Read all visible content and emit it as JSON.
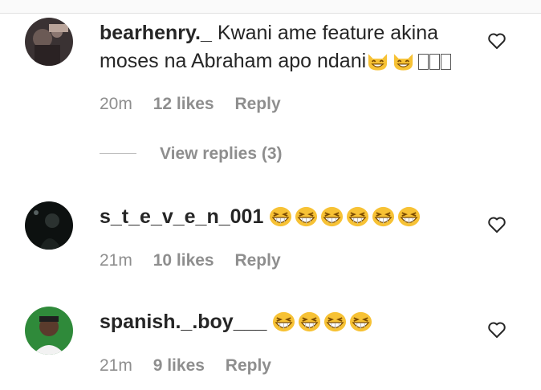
{
  "comments": [
    {
      "username": "bearhenry._",
      "text": "Kwani ame feature akina moses na Abraham apo ndani",
      "time": "20m",
      "likes": "12 likes",
      "reply": "Reply",
      "view_replies": "View replies (3)",
      "trailing_emoji": "cat-laughing-emoji x2, missing-glyph x3"
    },
    {
      "username": "s_t_e_v_e_n_001",
      "text": "",
      "time": "21m",
      "likes": "10 likes",
      "reply": "Reply",
      "trailing_emoji": "grinning-squinting-face-emoji x6"
    },
    {
      "username": "spanish._.boy___",
      "text": "",
      "time": "21m",
      "likes": "9 likes",
      "reply": "Reply",
      "trailing_emoji": "grinning-squinting-face-emoji x4"
    }
  ],
  "colors": {
    "text": "#262626",
    "meta": "#8e8e8e",
    "emoji": "#f7c235",
    "divider": "#e2e2e2"
  },
  "icons": {
    "like": "heart-outline-icon"
  }
}
